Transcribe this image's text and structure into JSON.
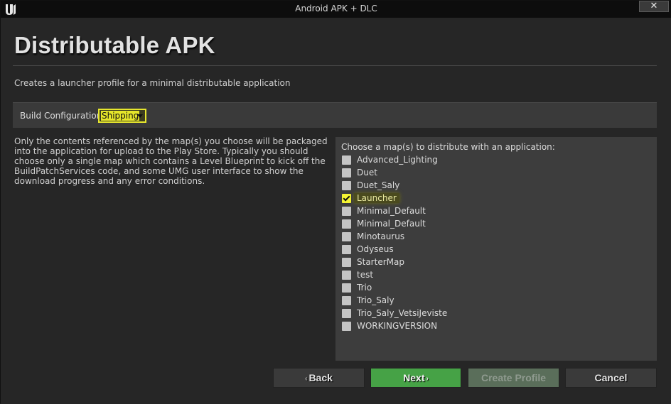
{
  "window": {
    "title": "Android APK + DLC",
    "close_label": "✕"
  },
  "page": {
    "title": "Distributable APK",
    "subtitle": "Creates a launcher profile for a minimal distributable application"
  },
  "build": {
    "label": "Build Configuration:",
    "value": "Shipping"
  },
  "description": "Only the contents referenced by the map(s) you choose will be packaged into the application for upload to the Play Store. Typically you should choose only a single map which contains a Level Blueprint to kick off the BuildPatchServices code, and some UMG user interface to show the download progress and any error conditions.",
  "maps": {
    "header": "Choose a map(s) to distribute with an application:",
    "items": [
      {
        "label": "Advanced_Lighting",
        "checked": false
      },
      {
        "label": "Duet",
        "checked": false
      },
      {
        "label": "Duet_Saly",
        "checked": false
      },
      {
        "label": "Launcher",
        "checked": true
      },
      {
        "label": "Minimal_Default",
        "checked": false
      },
      {
        "label": "Minimal_Default",
        "checked": false
      },
      {
        "label": "Minotaurus",
        "checked": false
      },
      {
        "label": "Odyseus",
        "checked": false
      },
      {
        "label": "StarterMap",
        "checked": false
      },
      {
        "label": "test",
        "checked": false
      },
      {
        "label": "Trio",
        "checked": false
      },
      {
        "label": "Trio_Saly",
        "checked": false
      },
      {
        "label": "Trio_Saly_VetsiJeviste",
        "checked": false
      },
      {
        "label": "WORKINGVERSION",
        "checked": false
      }
    ]
  },
  "buttons": {
    "back": "Back",
    "next": "Next",
    "create": "Create Profile",
    "cancel": "Cancel"
  },
  "colors": {
    "accent_highlight": "#e6e62a",
    "next_green": "#46a246",
    "disabled_green": "#5a6e5a"
  }
}
